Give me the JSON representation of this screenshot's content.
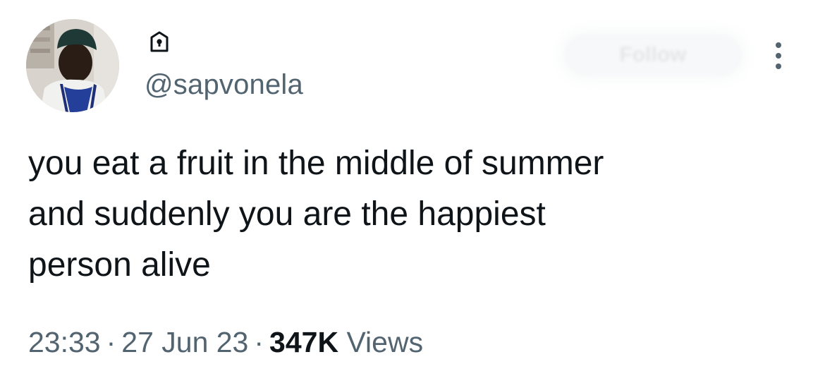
{
  "author": {
    "handle": "@sapvonela",
    "protected_icon": "lock-icon",
    "avatar": "profile-photo"
  },
  "follow_button": {
    "label": "Follow"
  },
  "more_icon": "more-vertical-icon",
  "tweet": {
    "text": "you eat a fruit in the middle of summer\nand suddenly you are the happiest\nperson alive",
    "time": "23:33",
    "separator": "·",
    "date": "27 Jun 23",
    "views_count": "347K",
    "views_label": "Views"
  },
  "colors": {
    "text_primary": "#0f1419",
    "text_secondary": "#536471"
  }
}
